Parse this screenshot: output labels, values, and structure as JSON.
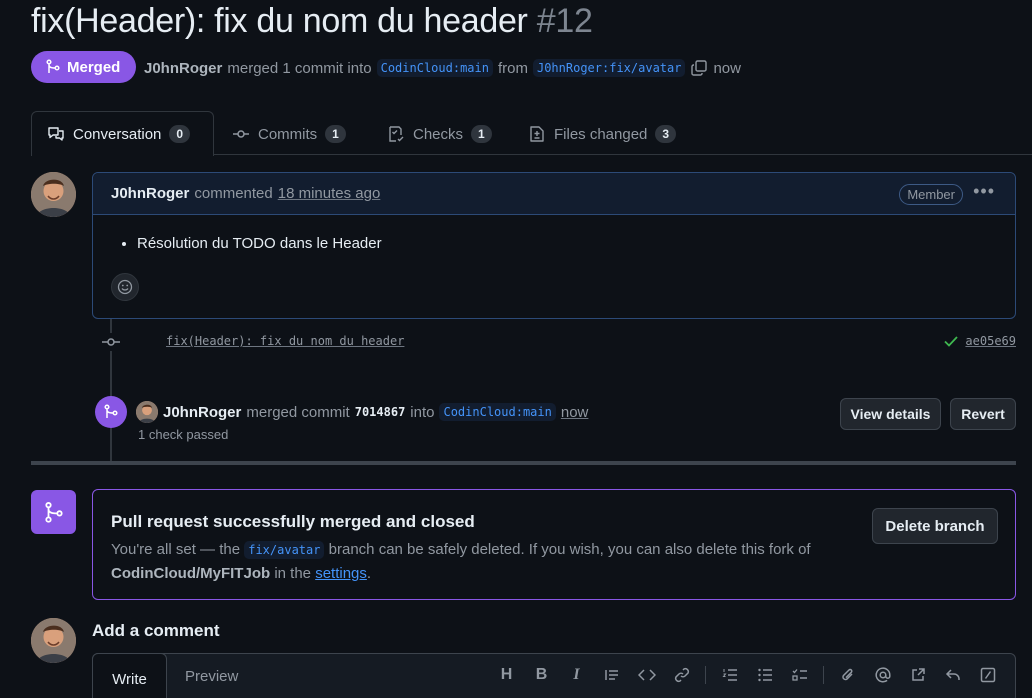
{
  "pr": {
    "title": "fix(Header): fix du nom du header",
    "number": "#12",
    "status": "Merged",
    "author": "J0hnRoger",
    "merge_text_1": "merged 1 commit into",
    "base_branch": "CodinCloud:main",
    "from_text": "from",
    "head_branch": "J0hnRoger:fix/avatar",
    "time": "now"
  },
  "tabs": [
    {
      "label": "Conversation",
      "count": "0"
    },
    {
      "label": "Commits",
      "count": "1"
    },
    {
      "label": "Checks",
      "count": "1"
    },
    {
      "label": "Files changed",
      "count": "3"
    }
  ],
  "comment": {
    "author": "J0hnRoger",
    "action": "commented",
    "time": "18 minutes ago",
    "badge": "Member",
    "body_item": "Résolution du TODO dans le Header"
  },
  "commit": {
    "message": "fix(Header): fix du nom du header",
    "sha": "ae05e69"
  },
  "merge_event": {
    "user": "J0hnRoger",
    "text_1": "merged commit",
    "sha": "7014867",
    "text_2": "into",
    "branch": "CodinCloud:main",
    "time": "now",
    "checks": "1 check passed",
    "view_details": "View details",
    "revert": "Revert"
  },
  "merged_box": {
    "title": "Pull request successfully merged and closed",
    "text_1": "You're all set — the",
    "branch": "fix/avatar",
    "text_2": "branch can be safely deleted. If you wish, you can also delete this fork of",
    "repo": "CodinCloud/MyFITJob",
    "text_3": "in the",
    "link": "settings",
    "text_4": ".",
    "delete_button": "Delete branch"
  },
  "add_comment": {
    "title": "Add a comment",
    "tab_write": "Write",
    "tab_preview": "Preview",
    "tools": [
      "heading-icon",
      "bold-icon",
      "italic-icon",
      "quote-icon",
      "code-icon",
      "link-icon",
      "ordered-list-icon",
      "unordered-list-icon",
      "task-list-icon",
      "attach-icon",
      "mention-icon",
      "reference-icon",
      "reply-icon",
      "slash-command-icon"
    ]
  },
  "colors": {
    "merged": "#8957e5",
    "link": "#4493f8",
    "background": "#0d1117"
  }
}
